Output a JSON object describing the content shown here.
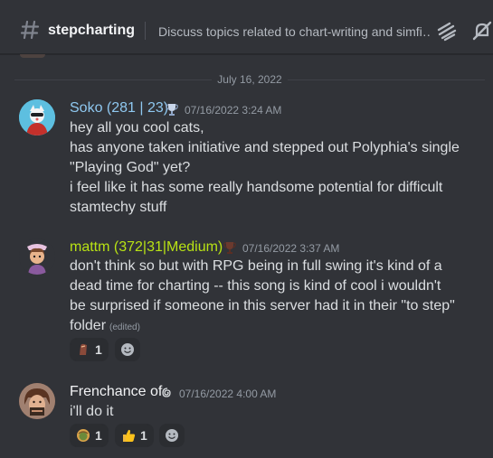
{
  "header": {
    "channel_name": "stepcharting",
    "topic": "Discuss topics related to chart-writing and simfi…",
    "icons": [
      "hash-icon",
      "threads-icon",
      "mute-bell-icon"
    ]
  },
  "date_divider": "July 16, 2022",
  "messages": [
    {
      "username": "Soko (281 | 23)",
      "username_color": "#8fc8f0",
      "badge": "trophy-icon",
      "timestamp": "07/16/2022 3:24 AM",
      "lines": [
        "hey all you cool cats,",
        "has anyone taken initiative and stepped out Polyphia's single",
        "\"Playing God\" yet?",
        "i feel like it has some really handsome potential for difficult",
        "stamtechy stuff"
      ]
    },
    {
      "username": "mattm (372|31|Medium)",
      "username_color": "#b9e314",
      "badge": "trophy-icon",
      "timestamp": "07/16/2022 3:37 AM",
      "lines": [
        "don't think so but with RPG being in full swing it's kind of a",
        "dead time for charting -- this song is kind of cool i wouldn't",
        "be surprised if someone in this server had it in their \"to step\"",
        "folder"
      ],
      "edited": "(edited)",
      "reactions": [
        {
          "emoji": "custom-emoji-icon",
          "count": "1"
        }
      ]
    },
    {
      "username": "Frenchance of",
      "username_color": "#f2f3f5",
      "badge": "spiral-icon",
      "timestamp": "07/16/2022 4:00 AM",
      "lines": [
        "i'll do it"
      ],
      "reactions": [
        {
          "emoji": "custom-emoji-icon",
          "count": "1"
        },
        {
          "emoji": "thumbs-up-icon",
          "count": "1"
        }
      ]
    }
  ]
}
